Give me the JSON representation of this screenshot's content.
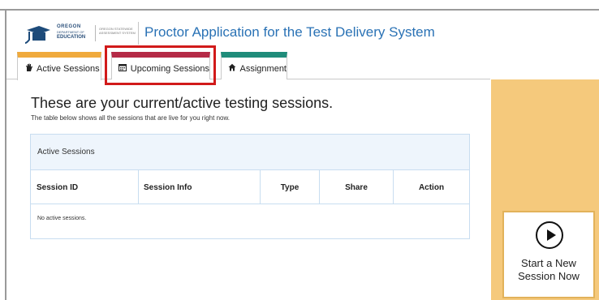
{
  "header": {
    "logo": {
      "state": "OREGON",
      "dept": "DEPARTMENT OF",
      "edu": "EDUCATION",
      "system_line1": "OREGON STATEWIDE",
      "system_line2": "ASSESSMENT SYSTEM"
    },
    "app_title": "Proctor Application for the Test Delivery System"
  },
  "tabs": [
    {
      "label": "Active Sessions",
      "icon": "hand-icon",
      "accent": "#f0aa3c",
      "active": true
    },
    {
      "label": "Upcoming Sessions",
      "icon": "calendar-icon",
      "accent": "#b52a47",
      "active": false
    },
    {
      "label": "Assignment",
      "icon": "home-icon",
      "accent": "#1f8c7a",
      "active": false
    }
  ],
  "highlight_color": "#d11a1a",
  "main": {
    "heading": "These are your current/active testing sessions.",
    "subheading": "The table below shows all the sessions that are live for you right now."
  },
  "table": {
    "panel_title": "Active Sessions",
    "columns": [
      "Session ID",
      "Session Info",
      "Type",
      "Share",
      "Action"
    ],
    "empty_message": "No active sessions."
  },
  "side": {
    "start_line1": "Start a New",
    "start_line2": "Session Now",
    "icon": "play-icon",
    "background": "#f5c97c"
  }
}
